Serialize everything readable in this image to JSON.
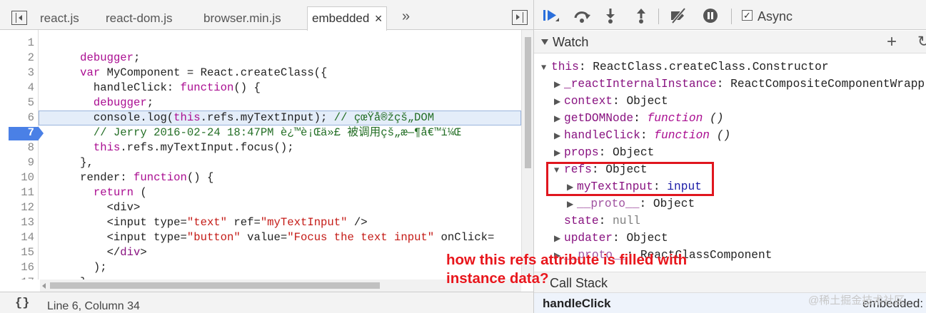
{
  "editor": {
    "tabs": [
      {
        "label": "react.js"
      },
      {
        "label": "react-dom.js"
      },
      {
        "label": "browser.min.js"
      },
      {
        "label": "embedded",
        "close": "×"
      }
    ],
    "more_tabs": "»",
    "lines": [
      {
        "n": "1",
        "parts": []
      },
      {
        "n": "2",
        "parts": [
          {
            "t": "      "
          },
          {
            "c": "kw",
            "t": "debugger"
          },
          {
            "t": ";"
          }
        ]
      },
      {
        "n": "3",
        "parts": [
          {
            "t": "      "
          },
          {
            "c": "kw",
            "t": "var"
          },
          {
            "t": " MyComponent = React.createClass({"
          }
        ]
      },
      {
        "n": "4",
        "parts": [
          {
            "t": "        handleClick: "
          },
          {
            "c": "kw",
            "t": "function"
          },
          {
            "t": "() {"
          }
        ]
      },
      {
        "n": "5",
        "parts": [
          {
            "t": "        "
          },
          {
            "c": "kw",
            "t": "debugger"
          },
          {
            "t": ";"
          }
        ]
      },
      {
        "n": "6",
        "parts": [
          {
            "t": "        console.log("
          },
          {
            "c": "kw",
            "t": "this"
          },
          {
            "t": ".refs.myTextInput); "
          },
          {
            "c": "cm",
            "t": "// çœŸå®žçš„DOM"
          }
        ]
      },
      {
        "n": "7",
        "parts": [
          {
            "t": "        "
          },
          {
            "c": "cm",
            "t": "// Jerry 2016-02-24 18:47PM è¿™è¡Œä»£ 被调用çš„æ—¶å€™ï¼Œ"
          }
        ]
      },
      {
        "n": "8",
        "parts": [
          {
            "t": "        "
          },
          {
            "c": "kw",
            "t": "this"
          },
          {
            "t": ".refs.myTextInput.focus();"
          }
        ]
      },
      {
        "n": "9",
        "parts": [
          {
            "t": "      },"
          }
        ]
      },
      {
        "n": "10",
        "parts": [
          {
            "t": "      render: "
          },
          {
            "c": "kw",
            "t": "function"
          },
          {
            "t": "() {"
          }
        ]
      },
      {
        "n": "11",
        "parts": [
          {
            "t": "        "
          },
          {
            "c": "kw",
            "t": "return"
          },
          {
            "t": " ("
          }
        ]
      },
      {
        "n": "12",
        "parts": [
          {
            "t": "          <div>"
          }
        ]
      },
      {
        "n": "13",
        "parts": [
          {
            "t": "          <input type="
          },
          {
            "c": "str",
            "t": "\"text\""
          },
          {
            "t": " ref="
          },
          {
            "c": "str",
            "t": "\"myTextInput\""
          },
          {
            "t": " />"
          }
        ]
      },
      {
        "n": "14",
        "parts": [
          {
            "t": "          <input type="
          },
          {
            "c": "str",
            "t": "\"button\""
          },
          {
            "t": " value="
          },
          {
            "c": "str",
            "t": "\"Focus the text input\""
          },
          {
            "t": " onClick="
          }
        ]
      },
      {
        "n": "15",
        "parts": [
          {
            "t": "          </"
          },
          {
            "c": "tag",
            "t": "div"
          },
          {
            "t": ">"
          }
        ]
      },
      {
        "n": "16",
        "parts": [
          {
            "t": "        );"
          }
        ]
      },
      {
        "n": "17",
        "parts": [
          {
            "t": "      }"
          }
        ]
      }
    ],
    "highlight_line": "6",
    "exec_line": "7",
    "status": {
      "pretty_print": "{}",
      "cursor": "Line 6, Column 34"
    }
  },
  "debugger": {
    "async_label": "Async",
    "async_checked": "✓",
    "watch_title": "Watch",
    "add_watch": "+",
    "refresh": "↻",
    "tree": [
      {
        "arrow": "▼",
        "key": "this",
        "sep": ": ",
        "value": "ReactClass.createClass.Constructor",
        "indent": 0,
        "plain": true
      },
      {
        "arrow": "▶",
        "key": "_reactInternalInstance",
        "sep": ": ",
        "value": "ReactCompositeComponentWrapp",
        "indent": 1
      },
      {
        "arrow": "▶",
        "key": "context",
        "sep": ": ",
        "value": "Object",
        "indent": 1
      },
      {
        "arrow": "▶",
        "key": "getDOMNode",
        "sep": ": ",
        "fnkw": "function",
        "value": " ()",
        "indent": 1,
        "fn": true
      },
      {
        "arrow": "▶",
        "key": "handleClick",
        "sep": ": ",
        "fnkw": "function",
        "value": " ()",
        "indent": 1,
        "fn": true
      },
      {
        "arrow": "▶",
        "key": "props",
        "sep": ": ",
        "value": "Object",
        "indent": 1
      },
      {
        "arrow": "▼",
        "key": "refs",
        "sep": ": ",
        "value": "Object",
        "indent": 1
      },
      {
        "arrow": "▶",
        "key": "myTextInput",
        "sep": ": ",
        "value": "input",
        "indent": 2,
        "str": true
      },
      {
        "arrow": "▶",
        "key": "__proto__",
        "sep": ": ",
        "value": "Object",
        "indent": 2,
        "dim": true
      },
      {
        "arrow": "",
        "key": "state",
        "sep": ": ",
        "value": "null",
        "indent": 1,
        "null": true
      },
      {
        "arrow": "▶",
        "key": "updater",
        "sep": ": ",
        "value": "Object",
        "indent": 1
      },
      {
        "arrow": "▶",
        "key": "__proto__",
        "sep": ": ",
        "value": "ReactClassComponent",
        "indent": 1,
        "dim": true
      }
    ],
    "callstack_title": "Call Stack",
    "frame": {
      "function": "handleClick",
      "location": "embedded:"
    }
  },
  "annotation": "how this refs attribute is filled with instance data?",
  "watermark": "@稀土掘金技术社区",
  "colors": {
    "highlight": "#e4edf9",
    "exec_marker": "#4a80e6",
    "annotation": "#e8161c",
    "refs_box": "#e0161e"
  }
}
